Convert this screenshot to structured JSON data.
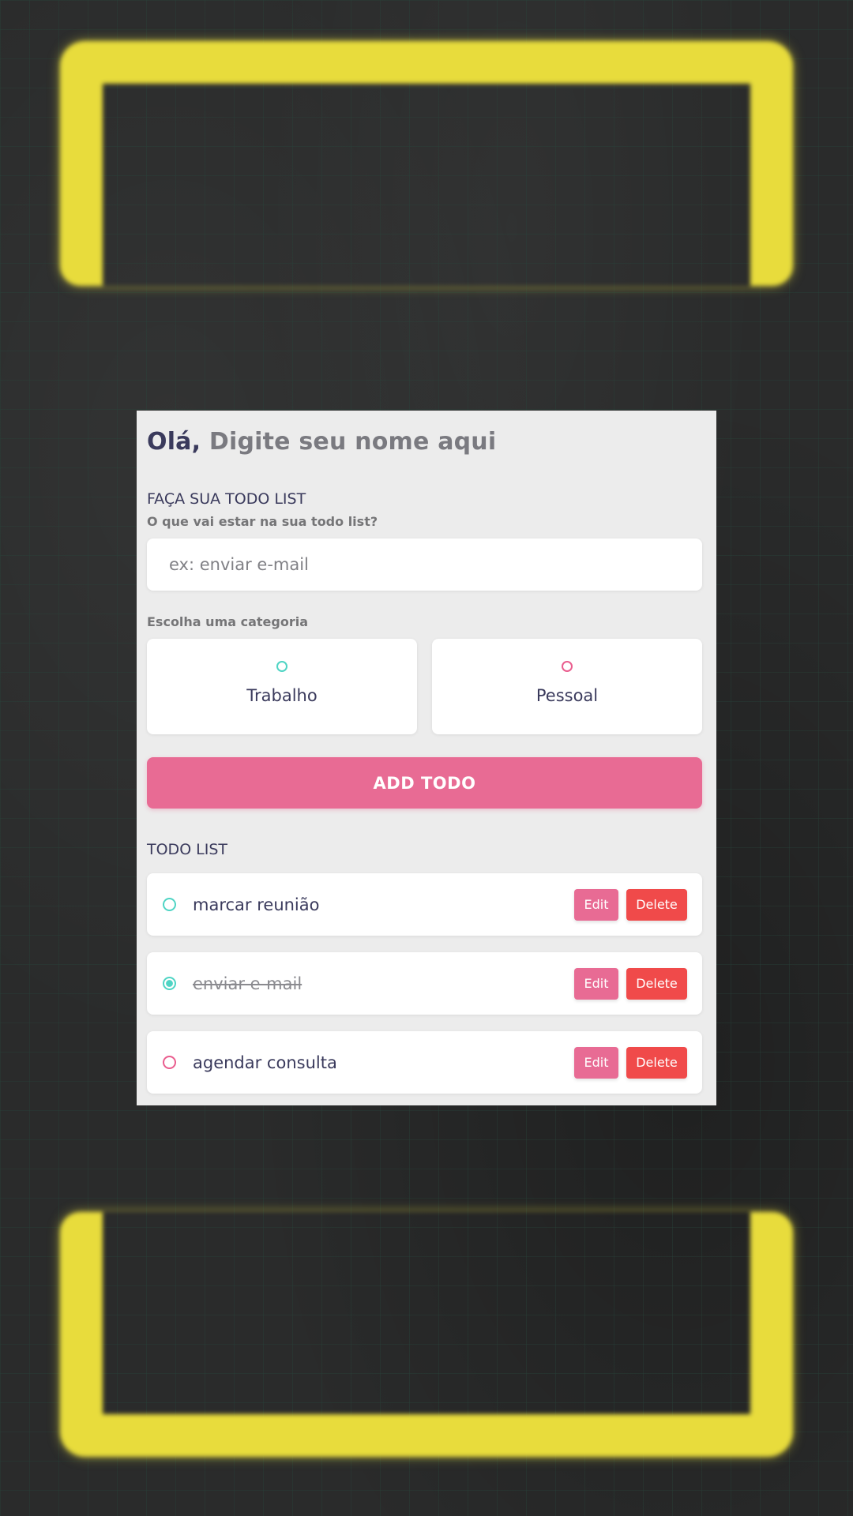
{
  "greeting": {
    "prefix": "Olá,",
    "name_placeholder": "Digite seu nome aqui"
  },
  "form": {
    "section_title": "FAÇA SUA TODO LIST",
    "input_label": "O que vai estar na sua todo list?",
    "input_placeholder": "ex: enviar e-mail",
    "input_value": "",
    "category_label": "Escolha uma categoria",
    "categories": [
      {
        "label": "Trabalho",
        "color": "#4fd4c4"
      },
      {
        "label": "Pessoal",
        "color": "#ea5d8e"
      }
    ],
    "add_button_label": "ADD TODO"
  },
  "list": {
    "title": "TODO LIST",
    "items": [
      {
        "text": "marcar reunião",
        "category": "Trabalho",
        "done": false,
        "edit_label": "Edit",
        "delete_label": "Delete"
      },
      {
        "text": "enviar e-mail",
        "category": "Trabalho",
        "done": true,
        "edit_label": "Edit",
        "delete_label": "Delete"
      },
      {
        "text": "agendar consulta",
        "category": "Pessoal",
        "done": false,
        "edit_label": "Edit",
        "delete_label": "Delete"
      }
    ]
  },
  "colors": {
    "accent_pink": "#e86b94",
    "delete_red": "#f04a4a",
    "work_teal": "#4fd4c4",
    "personal_pink": "#ea5d8e",
    "neon_yellow": "#e8dc3c",
    "text_dark": "#3a3a5c"
  }
}
